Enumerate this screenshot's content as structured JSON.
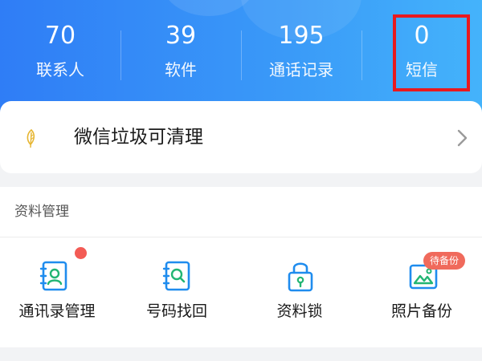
{
  "stats": [
    {
      "value": "70",
      "label": "联系人"
    },
    {
      "value": "39",
      "label": "软件"
    },
    {
      "value": "195",
      "label": "通话记录"
    },
    {
      "value": "0",
      "label": "短信"
    }
  ],
  "cleanup": {
    "title": "微信垃圾可清理",
    "icon": "leaf-icon",
    "chevron": "chevron-right-icon"
  },
  "data_management": {
    "title": "资料管理",
    "tools": [
      {
        "label": "通讯录管理",
        "icon": "contacts-book-icon",
        "has_dot": true
      },
      {
        "label": "号码找回",
        "icon": "search-book-icon"
      },
      {
        "label": "资料锁",
        "icon": "lock-icon"
      },
      {
        "label": "照片备份",
        "icon": "photo-icon",
        "badge": "待备份"
      }
    ]
  },
  "colors": {
    "header_start": "#2f7df6",
    "header_end": "#44b3fb",
    "accent_blue": "#1f8cee",
    "accent_green": "#22b573",
    "badge_red": "#f06a5c",
    "highlight_red": "#e8191f"
  }
}
